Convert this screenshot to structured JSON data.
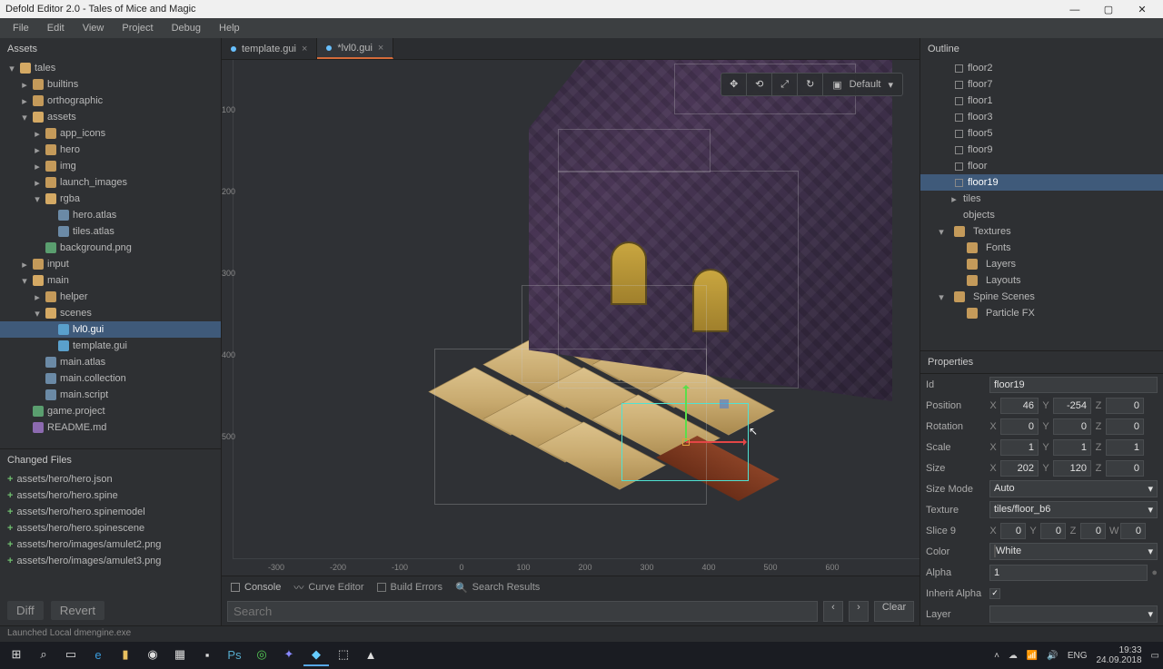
{
  "title": "Defold Editor 2.0 - Tales of Mice and Magic",
  "menu": [
    "File",
    "Edit",
    "View",
    "Project",
    "Debug",
    "Help"
  ],
  "panels": {
    "assets": "Assets",
    "changed": "Changed Files",
    "outline": "Outline",
    "properties": "Properties"
  },
  "assets_tree": [
    {
      "d": 0,
      "exp": true,
      "ic": "folder-open",
      "n": "tales"
    },
    {
      "d": 1,
      "exp": false,
      "ic": "folder",
      "n": "builtins"
    },
    {
      "d": 1,
      "exp": false,
      "ic": "folder",
      "n": "orthographic"
    },
    {
      "d": 1,
      "exp": true,
      "ic": "folder-open",
      "n": "assets"
    },
    {
      "d": 2,
      "exp": false,
      "ic": "folder",
      "n": "app_icons"
    },
    {
      "d": 2,
      "exp": false,
      "ic": "folder",
      "n": "hero"
    },
    {
      "d": 2,
      "exp": false,
      "ic": "folder",
      "n": "img"
    },
    {
      "d": 2,
      "exp": false,
      "ic": "folder",
      "n": "launch_images"
    },
    {
      "d": 2,
      "exp": true,
      "ic": "folder-open",
      "n": "rgba"
    },
    {
      "d": 3,
      "ic": "file",
      "n": "hero.atlas"
    },
    {
      "d": 3,
      "ic": "file",
      "n": "tiles.atlas"
    },
    {
      "d": 2,
      "ic": "img",
      "n": "background.png"
    },
    {
      "d": 1,
      "exp": false,
      "ic": "folder",
      "n": "input"
    },
    {
      "d": 1,
      "exp": true,
      "ic": "folder-open",
      "n": "main"
    },
    {
      "d": 2,
      "exp": false,
      "ic": "folder",
      "n": "helper"
    },
    {
      "d": 2,
      "exp": true,
      "ic": "folder-open",
      "n": "scenes"
    },
    {
      "d": 3,
      "ic": "gui",
      "n": "lvl0.gui",
      "sel": true
    },
    {
      "d": 3,
      "ic": "gui",
      "n": "template.gui"
    },
    {
      "d": 2,
      "ic": "file",
      "n": "main.atlas"
    },
    {
      "d": 2,
      "ic": "file",
      "n": "main.collection"
    },
    {
      "d": 2,
      "ic": "file",
      "n": "main.script"
    },
    {
      "d": 1,
      "ic": "img",
      "n": "game.project"
    },
    {
      "d": 1,
      "ic": "md",
      "n": "README.md"
    }
  ],
  "changed": [
    "assets/hero/hero.json",
    "assets/hero/hero.spine",
    "assets/hero/hero.spinemodel",
    "assets/hero/hero.spinescene",
    "assets/hero/images/amulet2.png",
    "assets/hero/images/amulet3.png"
  ],
  "changed_btns": {
    "diff": "Diff",
    "revert": "Revert"
  },
  "tabs": [
    {
      "n": "template.gui",
      "active": false,
      "dirty": false
    },
    {
      "n": "*lvl0.gui",
      "active": true,
      "dirty": true
    }
  ],
  "camera_label": "Default",
  "ruler_v": [
    "100",
    "200",
    "300",
    "400",
    "500"
  ],
  "ruler_h": [
    "-300",
    "-200",
    "-100",
    "0",
    "100",
    "200",
    "300",
    "400",
    "500",
    "600"
  ],
  "bottom_tabs": [
    "Console",
    "Curve Editor",
    "Build Errors",
    "Search Results"
  ],
  "bottom_search": {
    "ph": "Search",
    "prev": "‹",
    "next": "›",
    "clear": "Clear"
  },
  "outline": [
    {
      "n": "floor2"
    },
    {
      "n": "floor7"
    },
    {
      "n": "floor1"
    },
    {
      "n": "floor3"
    },
    {
      "n": "floor5"
    },
    {
      "n": "floor9"
    },
    {
      "n": "floor"
    },
    {
      "n": "floor19",
      "sel": true
    },
    {
      "n": "tiles",
      "fold": true,
      "d": 1,
      "exp": false
    },
    {
      "n": "objects",
      "fold": true,
      "d": 1,
      "leaf": true
    },
    {
      "n": "Textures",
      "fold": true,
      "d": 0,
      "exp": true,
      "ico": "folder"
    },
    {
      "n": "Fonts",
      "fold": true,
      "d": 1,
      "ico": "folder"
    },
    {
      "n": "Layers",
      "fold": true,
      "d": 1,
      "ico": "folder"
    },
    {
      "n": "Layouts",
      "fold": true,
      "d": 1,
      "ico": "folder"
    },
    {
      "n": "Spine Scenes",
      "fold": true,
      "d": 0,
      "exp": true,
      "ico": "folder"
    },
    {
      "n": "Particle FX",
      "fold": true,
      "d": 1,
      "ico": "folder"
    }
  ],
  "props": {
    "id": "floor19",
    "position": {
      "x": "46",
      "y": "-254",
      "z": "0"
    },
    "rotation": {
      "x": "0",
      "y": "0",
      "z": "0"
    },
    "scale": {
      "x": "1",
      "y": "1",
      "z": "1"
    },
    "size": {
      "x": "202",
      "y": "120",
      "z": "0"
    },
    "size_mode": "Auto",
    "texture": "tiles/floor_b6",
    "slice9": {
      "x": "0",
      "y": "0",
      "z": "0",
      "w": "0"
    },
    "color": "White",
    "alpha": "1",
    "inherit_alpha": true,
    "layer": ""
  },
  "prop_labels": {
    "id": "Id",
    "position": "Position",
    "rotation": "Rotation",
    "scale": "Scale",
    "size": "Size",
    "size_mode": "Size Mode",
    "texture": "Texture",
    "slice9": "Slice 9",
    "color": "Color",
    "alpha": "Alpha",
    "inherit_alpha": "Inherit Alpha",
    "layer": "Layer"
  },
  "axis": {
    "x": "X",
    "y": "Y",
    "z": "Z",
    "w": "W"
  },
  "status": "Launched Local dmengine.exe",
  "tray": {
    "lang": "ENG",
    "time": "19:33",
    "date": "24.09.2018"
  }
}
